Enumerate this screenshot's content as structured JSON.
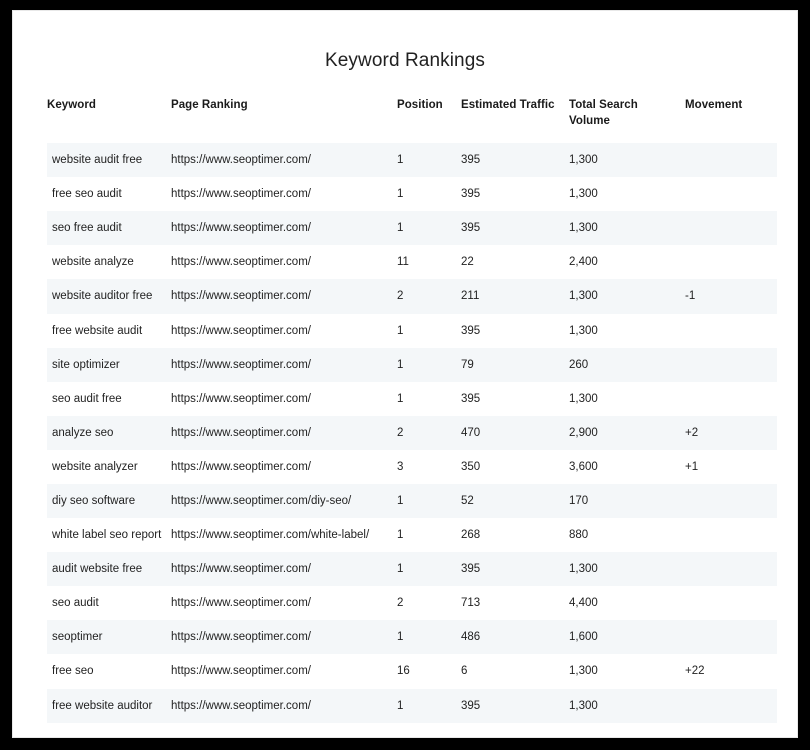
{
  "document": {
    "title": "Keyword Rankings"
  },
  "table": {
    "columns": [
      {
        "key": "keyword",
        "label": "Keyword"
      },
      {
        "key": "url",
        "label": "Page Ranking"
      },
      {
        "key": "position",
        "label": "Position"
      },
      {
        "key": "traffic",
        "label": "Estimated Traffic"
      },
      {
        "key": "volume",
        "label": "Total Search Volume"
      },
      {
        "key": "movement",
        "label": "Movement"
      }
    ],
    "rows": [
      {
        "keyword": "website audit free",
        "url": "https://www.seoptimer.com/",
        "position": "1",
        "traffic": "395",
        "volume": "1,300",
        "movement": ""
      },
      {
        "keyword": "free seo audit",
        "url": "https://www.seoptimer.com/",
        "position": "1",
        "traffic": "395",
        "volume": "1,300",
        "movement": ""
      },
      {
        "keyword": "seo free audit",
        "url": "https://www.seoptimer.com/",
        "position": "1",
        "traffic": "395",
        "volume": "1,300",
        "movement": ""
      },
      {
        "keyword": "website analyze",
        "url": "https://www.seoptimer.com/",
        "position": "11",
        "traffic": "22",
        "volume": "2,400",
        "movement": ""
      },
      {
        "keyword": "website auditor free",
        "url": "https://www.seoptimer.com/",
        "position": "2",
        "traffic": "211",
        "volume": "1,300",
        "movement": "-1"
      },
      {
        "keyword": "free website audit",
        "url": "https://www.seoptimer.com/",
        "position": "1",
        "traffic": "395",
        "volume": "1,300",
        "movement": ""
      },
      {
        "keyword": "site optimizer",
        "url": "https://www.seoptimer.com/",
        "position": "1",
        "traffic": "79",
        "volume": "260",
        "movement": ""
      },
      {
        "keyword": "seo audit free",
        "url": "https://www.seoptimer.com/",
        "position": "1",
        "traffic": "395",
        "volume": "1,300",
        "movement": ""
      },
      {
        "keyword": "analyze seo",
        "url": "https://www.seoptimer.com/",
        "position": "2",
        "traffic": "470",
        "volume": "2,900",
        "movement": "+2"
      },
      {
        "keyword": "website analyzer",
        "url": "https://www.seoptimer.com/",
        "position": "3",
        "traffic": "350",
        "volume": "3,600",
        "movement": "+1"
      },
      {
        "keyword": "diy seo software",
        "url": "https://www.seoptimer.com/diy-seo/",
        "position": "1",
        "traffic": "52",
        "volume": "170",
        "movement": ""
      },
      {
        "keyword": "white label seo report",
        "url": "https://www.seoptimer.com/white-label/",
        "position": "1",
        "traffic": "268",
        "volume": "880",
        "movement": ""
      },
      {
        "keyword": "audit website free",
        "url": "https://www.seoptimer.com/",
        "position": "1",
        "traffic": "395",
        "volume": "1,300",
        "movement": ""
      },
      {
        "keyword": "seo audit",
        "url": "https://www.seoptimer.com/",
        "position": "2",
        "traffic": "713",
        "volume": "4,400",
        "movement": ""
      },
      {
        "keyword": "seoptimer",
        "url": "https://www.seoptimer.com/",
        "position": "1",
        "traffic": "486",
        "volume": "1,600",
        "movement": ""
      },
      {
        "keyword": "free seo",
        "url": "https://www.seoptimer.com/",
        "position": "16",
        "traffic": "6",
        "volume": "1,300",
        "movement": "+22"
      },
      {
        "keyword": "free website auditor",
        "url": "https://www.seoptimer.com/",
        "position": "1",
        "traffic": "395",
        "volume": "1,300",
        "movement": ""
      }
    ]
  },
  "colors": {
    "frame": "#000000",
    "card": "#ffffff",
    "stripe": "#f4f7f9",
    "text": "#222222",
    "header_text": "#1a1a1a"
  }
}
